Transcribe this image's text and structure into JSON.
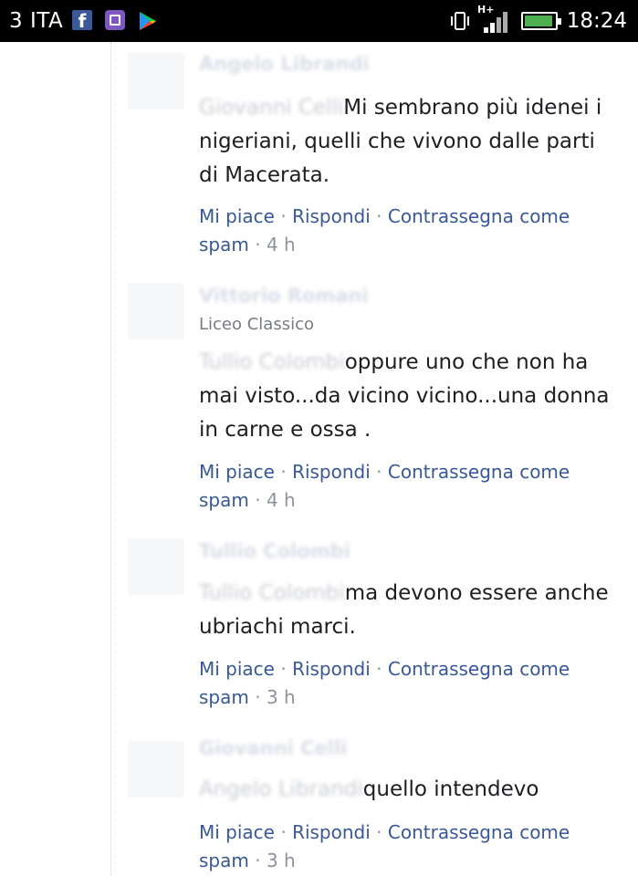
{
  "status_bar": {
    "carrier": "3 ITA",
    "time": "18:24",
    "network": "H+",
    "icons": [
      "facebook-icon",
      "gallery-icon",
      "play-store-icon",
      "vibrate-icon",
      "signal-icon",
      "battery-charging-icon"
    ]
  },
  "actions": {
    "like": "Mi piace",
    "reply": "Rispondi",
    "flag": "Contrassegna come spam",
    "sep": "·"
  },
  "comments": [
    {
      "name": "Angelo Librandi",
      "mention": "Giovanni Celli",
      "text": "Mi sembrano più idenei i nigeriani, quelli che vivono dalle parti di Macerata.",
      "time": "4 h"
    },
    {
      "name": "Vittorio Romani",
      "subtitle": "Liceo Classico",
      "mention": "Tullio Colombi",
      "text": "oppure uno che non ha mai visto...da vicino vicino...una donna in carne e ossa .",
      "time": "4 h"
    },
    {
      "name": "Tullio Colombi",
      "mention": "Tullio Colombi",
      "text": "ma devono essere anche ubriachi marci.",
      "time": "3 h"
    },
    {
      "name": "Giovanni Celli",
      "mention": "Angelo Librandi",
      "text": "quello intendevo",
      "time": "3 h"
    }
  ]
}
